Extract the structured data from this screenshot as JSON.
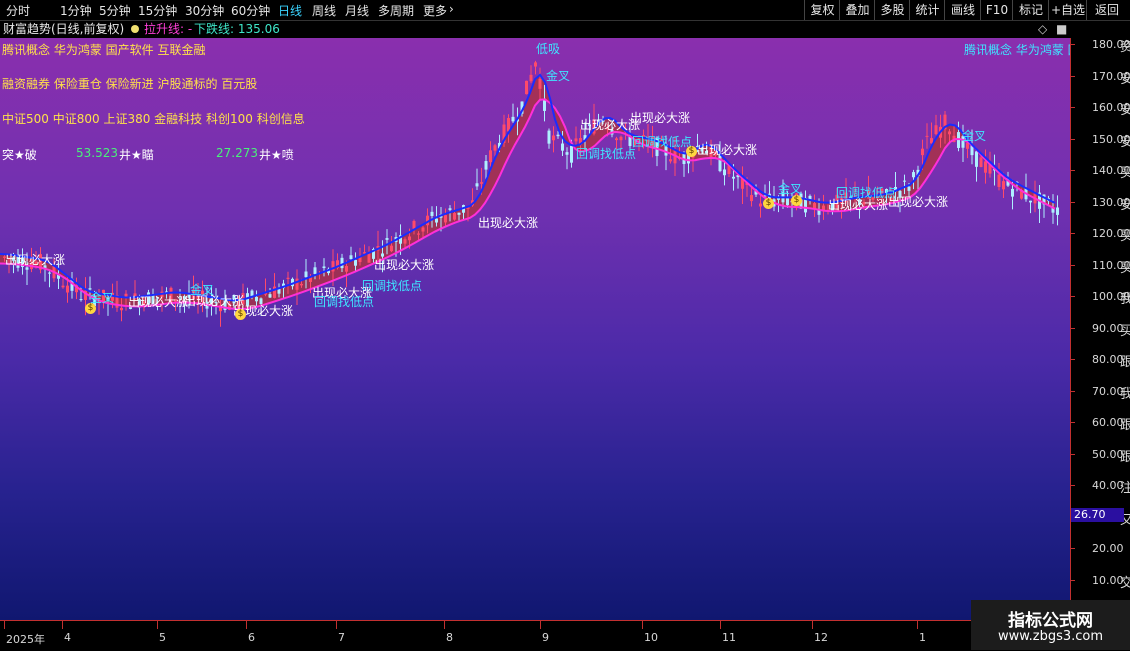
{
  "toolbar": {
    "periods": [
      "分时",
      "1分钟",
      "5分钟",
      "15分钟",
      "30分钟",
      "60分钟",
      "日线",
      "周线",
      "月线",
      "多周期",
      "更多"
    ],
    "active_period": "日线",
    "more_arrow": "›",
    "right_buttons": [
      "复权",
      "叠加",
      "多股",
      "统计",
      "画线",
      "F10",
      "标记",
      "+自选",
      "返回"
    ]
  },
  "infobar": {
    "title": "财富趋势(日线,前复权)",
    "indicator_name": "拉升线: -",
    "down_line": "下跌线: 135.06",
    "marker_icon": "diamond-icon",
    "marker_glyph": "◇",
    "window_icon": "square-icon",
    "window_glyph": "■"
  },
  "notes": {
    "concept_line": "腾讯概念 华为鸿蒙 国产软件 互联金融",
    "concept_line_right": "腾讯概念 华为鸿蒙 国",
    "margin_line": "融资融券 保险重仓 保险新进 沪股通标的 百元股",
    "index_line": "中证500 中证800 上证380 金融科技 科创100 科创信息",
    "stat_left_label": "突★破",
    "stat_mid_value": "53.523",
    "stat_mid_label": "井★瞄",
    "stat_right_value": "27.273",
    "stat_right_label": "井★喷"
  },
  "yaxis": {
    "labels": [
      "180.00",
      "170.00",
      "160.00",
      "150.00",
      "140.00",
      "130.00",
      "120.00",
      "110.00",
      "100.00",
      "90.00",
      "80.00",
      "70.00",
      "60.00",
      "50.00",
      "40.00",
      "30.00",
      "20.00",
      "10.00"
    ],
    "edge_glyphs": [
      "资",
      "安",
      "安",
      "安",
      "买",
      "安",
      "买",
      "买",
      "我",
      "买",
      "跟",
      "我",
      "跟",
      "跟",
      "注",
      "又",
      "",
      "交"
    ],
    "current_price": "26.70"
  },
  "xaxis": {
    "labels": [
      "2025年",
      "4",
      "5",
      "6",
      "7",
      "8",
      "9",
      "10",
      "11",
      "12",
      "1"
    ]
  },
  "chart_labels": {
    "chuxian": "出现必大涨",
    "huitiao": "回调找低点",
    "jincha": "金叉",
    "dixi": "低吸",
    "money_icon": "money-bag-icon",
    "money_glyph": "$"
  },
  "colors": {
    "bg_top": "#8a2fae",
    "bg_bottom": "#101770",
    "up_line": "#ff2fd8",
    "down_line": "#1a2cff",
    "fill_up": "#b0323a",
    "fill_down": "#0a7a5a",
    "candle_up": "#ff4a6a",
    "candle_down": "#aef0ff",
    "accent": "#3ad4ff"
  },
  "watermark": {
    "title": "指标公式网",
    "url": "www.zbgs3.com"
  }
}
